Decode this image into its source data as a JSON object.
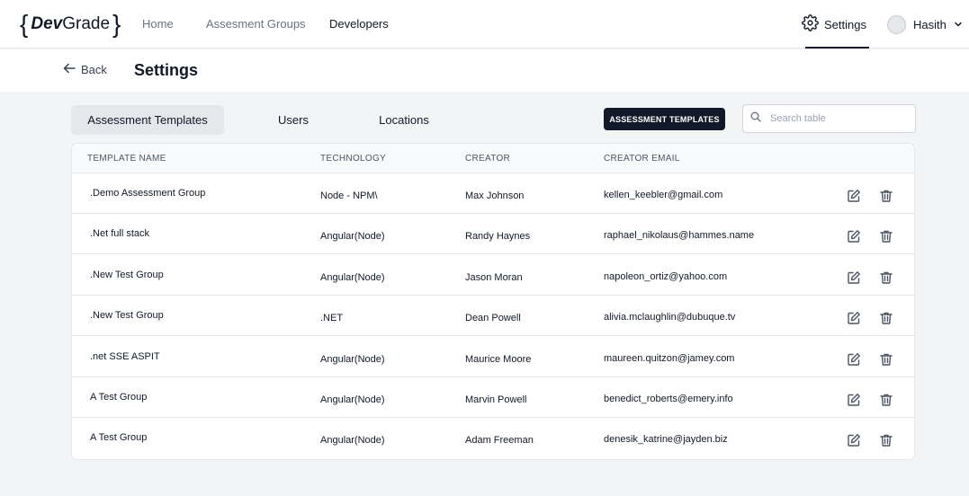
{
  "brand": {
    "open_brace": "{",
    "dev": "Dev",
    "grade": "Grade",
    "close_brace": "}"
  },
  "nav": {
    "home": "Home",
    "assessment_groups": "Assesment Groups",
    "developers": "Developers",
    "settings": "Settings",
    "user_name": "Hasith"
  },
  "subheader": {
    "back_label": "Back",
    "title": "Settings"
  },
  "tabs": [
    {
      "label": "Assessment Templates",
      "active": true
    },
    {
      "label": "Users",
      "active": false
    },
    {
      "label": "Locations",
      "active": false
    }
  ],
  "primary_button": "ASSESSMENT TEMPLATES",
  "search": {
    "placeholder": "Search table",
    "value": ""
  },
  "table": {
    "columns": [
      "TEMPLATE NAME",
      "TECHNOLOGY",
      "CREATOR",
      "CREATOR EMAIL"
    ],
    "rows": [
      {
        "name": ".Demo Assessment Group",
        "technology": "Node - NPM\\",
        "creator": "Max Johnson",
        "email": "kellen_keebler@gmail.com"
      },
      {
        "name": ".Net full stack",
        "technology": "Angular(Node)",
        "creator": "Randy Haynes",
        "email": "raphael_nikolaus@hammes.name"
      },
      {
        "name": ".New Test Group",
        "technology": "Angular(Node)",
        "creator": "Jason Moran",
        "email": "napoleon_ortiz@yahoo.com"
      },
      {
        "name": ".New Test Group",
        "technology": ".NET",
        "creator": "Dean Powell",
        "email": "alivia.mclaughlin@dubuque.tv"
      },
      {
        "name": ".net SSE ASPIT",
        "technology": "Angular(Node)",
        "creator": "Maurice Moore",
        "email": "maureen.quitzon@jamey.com"
      },
      {
        "name": "A Test Group",
        "technology": "Angular(Node)",
        "creator": "Marvin Powell",
        "email": "benedict_roberts@emery.info"
      },
      {
        "name": "A Test Group",
        "technology": "Angular(Node)",
        "creator": "Adam Freeman",
        "email": "denesik_katrine@jayden.biz"
      }
    ]
  },
  "icons": {
    "settings": "gear-icon",
    "back": "arrow-left-icon",
    "user_menu": "chevron-down-icon",
    "search": "search-icon",
    "edit": "edit-icon",
    "delete": "trash-icon"
  },
  "colors": {
    "primary": "#111827",
    "page_bg": "#f3f4f6",
    "active_tab_bg": "#e5e7eb",
    "muted_text": "#6b7280"
  }
}
